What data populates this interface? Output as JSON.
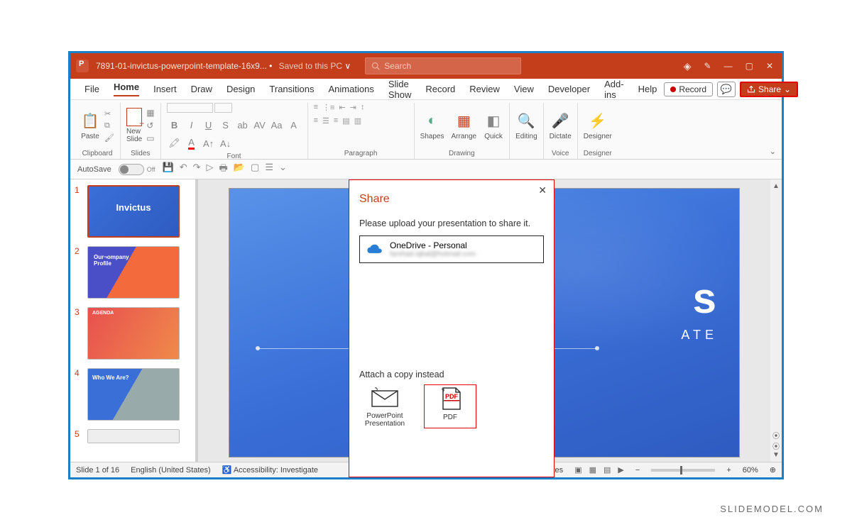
{
  "titlebar": {
    "filename": "7891-01-invictus-powerpoint-template-16x9...",
    "saved_status": "Saved to this PC",
    "search_placeholder": "Search"
  },
  "menu": {
    "tabs": [
      "File",
      "Home",
      "Insert",
      "Draw",
      "Design",
      "Transitions",
      "Animations",
      "Slide Show",
      "Record",
      "Review",
      "View",
      "Developer",
      "Add-ins",
      "Help"
    ],
    "active": "Home",
    "record_label": "Record",
    "share_label": "Share"
  },
  "ribbon": {
    "groups": {
      "clipboard": {
        "paste": "Paste",
        "label": "Clipboard"
      },
      "slides": {
        "newslide": "New\nSlide",
        "label": "Slides"
      },
      "font": {
        "label": "Font"
      },
      "paragraph": {
        "label": "Paragraph"
      },
      "drawing": {
        "shapes": "Shapes",
        "arrange": "Arrange",
        "quick": "Quick",
        "label": "Drawing"
      },
      "editing": {
        "editing": "Editing"
      },
      "voice": {
        "dictate": "Dictate",
        "label": "Voice"
      },
      "designer": {
        "designer": "Designer",
        "label": "Designer"
      }
    }
  },
  "qat": {
    "autosave_label": "AutoSave",
    "autosave_state": "Off"
  },
  "thumbs": [
    {
      "num": "1",
      "title": "Invictus"
    },
    {
      "num": "2",
      "title": "Our Company Profile"
    },
    {
      "num": "3",
      "title": "AGENDA"
    },
    {
      "num": "4",
      "title": "Who We Are?"
    },
    {
      "num": "5",
      "title": ""
    }
  ],
  "canvas": {
    "title_fragment": "s",
    "subtitle_fragment": "ATE"
  },
  "dialog": {
    "title": "Share",
    "prompt": "Please upload your presentation to share it.",
    "account_name": "OneDrive - Personal",
    "account_email": "farshad.iqbal@hotmail.com",
    "attach_label": "Attach a copy instead",
    "opt_pp": "PowerPoint\nPresentation",
    "opt_pdf": "PDF"
  },
  "status": {
    "slide": "Slide 1 of 16",
    "lang": "English (United States)",
    "access": "Accessibility: Investigate",
    "notes": "Notes",
    "zoom": "60%"
  },
  "watermark": "SLIDEMODEL.COM"
}
